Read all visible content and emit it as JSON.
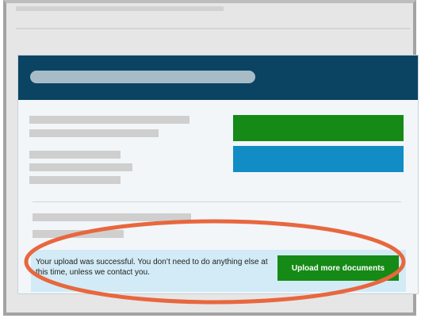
{
  "notice": {
    "message": "Your upload was successful. You don’t need to do anything else at this time, unless we contact you.",
    "upload_more_label": "Upload more documents"
  },
  "colors": {
    "header_bg": "#0b4462",
    "primary_button": "#168a16",
    "secondary_button": "#128cc4",
    "notice_bg": "#d2ebf6",
    "highlight_ellipse": "#e8673e"
  },
  "annotation": {
    "shape": "ellipse",
    "highlights": "upload-success-notice"
  }
}
